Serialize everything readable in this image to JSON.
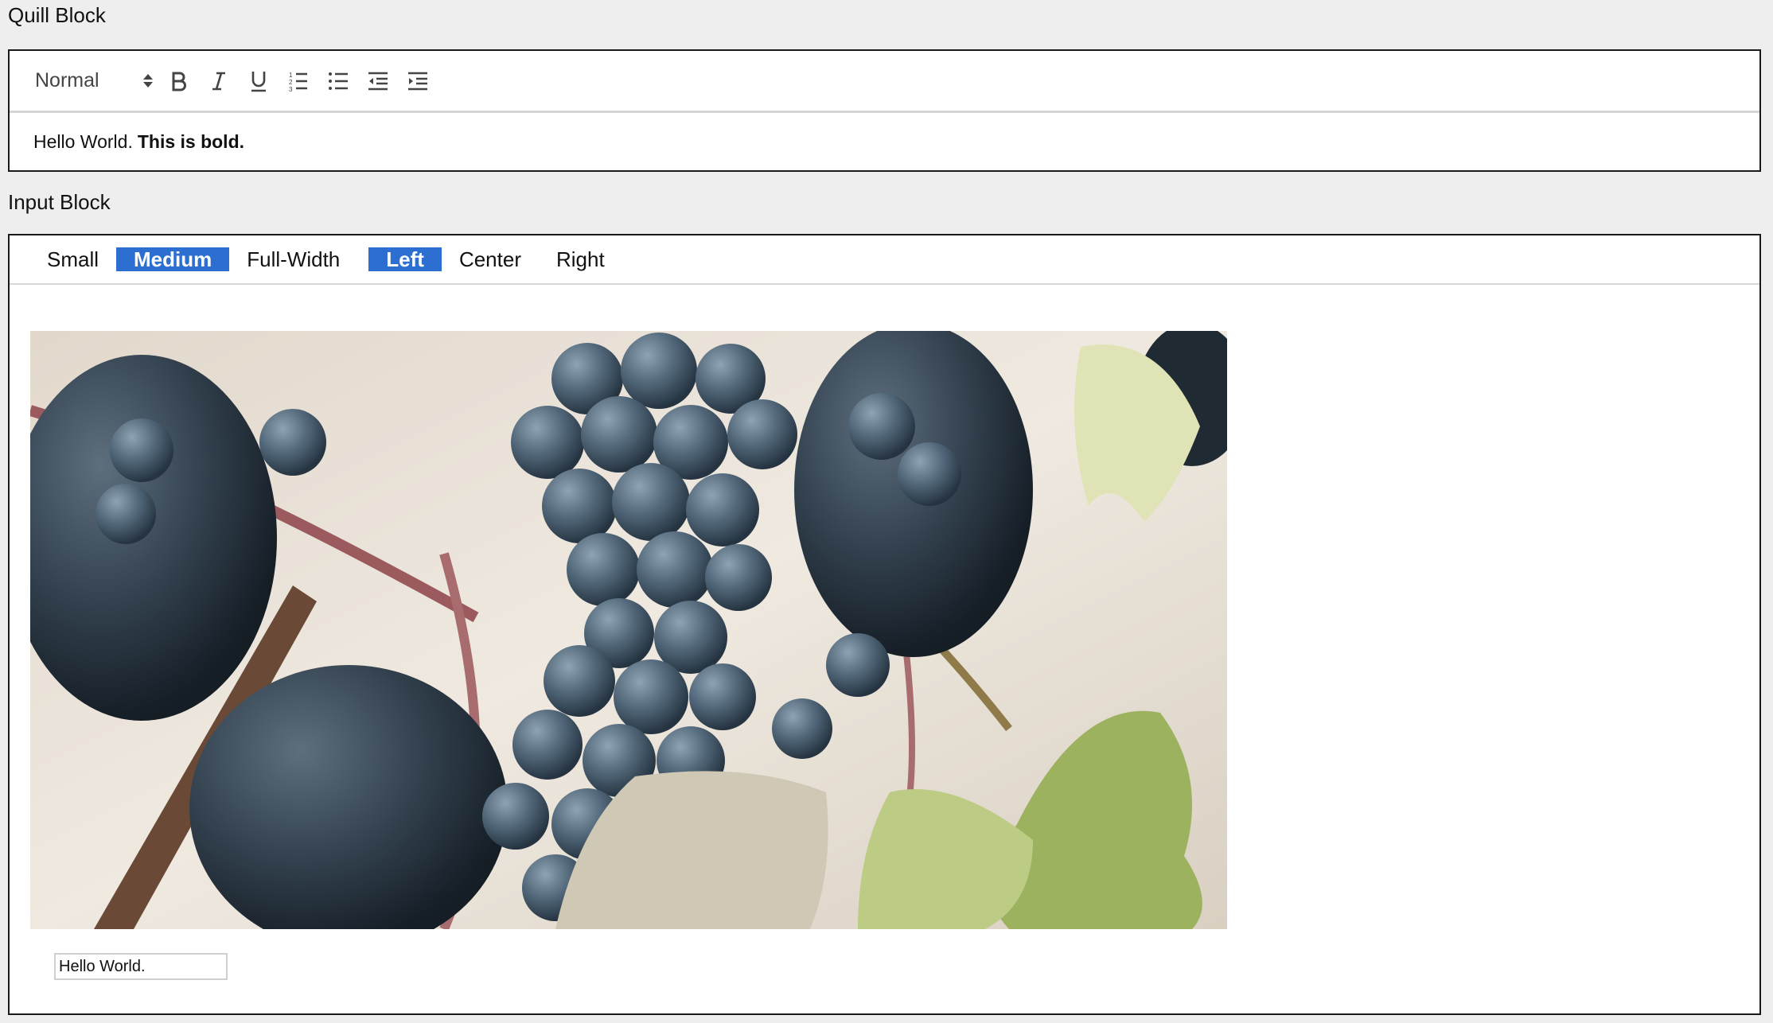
{
  "quill": {
    "section_label": "Quill Block",
    "header_select": "Normal",
    "toolbar_icons": [
      "bold-icon",
      "italic-icon",
      "underline-icon",
      "ordered-list-icon",
      "bullet-list-icon",
      "outdent-icon",
      "indent-icon"
    ],
    "content_normal": "Hello World.",
    "content_bold": "This is bold."
  },
  "input_block": {
    "section_label": "Input Block",
    "size_options": [
      "Small",
      "Medium",
      "Full-Width"
    ],
    "size_selected": "Medium",
    "align_options": [
      "Left",
      "Center",
      "Right"
    ],
    "align_selected": "Left",
    "image_subject": "grapes-on-vine",
    "caption_value": "Hello World."
  },
  "colors": {
    "page_bg": "#eeeeee",
    "accent": "#2d6fd1",
    "border": "#1a1a1a"
  }
}
